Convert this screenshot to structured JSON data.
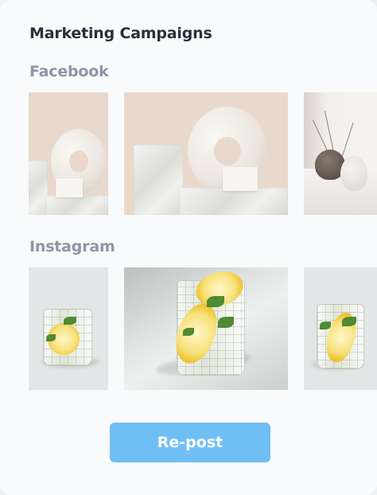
{
  "card": {
    "title": "Marketing Campaigns"
  },
  "sections": [
    {
      "label": "Facebook",
      "images": [
        "vase-donut-photo",
        "vase-donut-photo",
        "vases-on-shelf-photo"
      ]
    },
    {
      "label": "Instagram",
      "images": [
        "lemon-mint-drink-photo",
        "lemon-mint-drink-photo",
        "lemon-mint-drink-photo"
      ]
    }
  ],
  "actions": {
    "repost_label": "Re-post"
  },
  "colors": {
    "title": "#2a2f3d",
    "section_label": "#8f95a6",
    "button_bg": "#6fbff5",
    "button_text": "#ffffff"
  }
}
